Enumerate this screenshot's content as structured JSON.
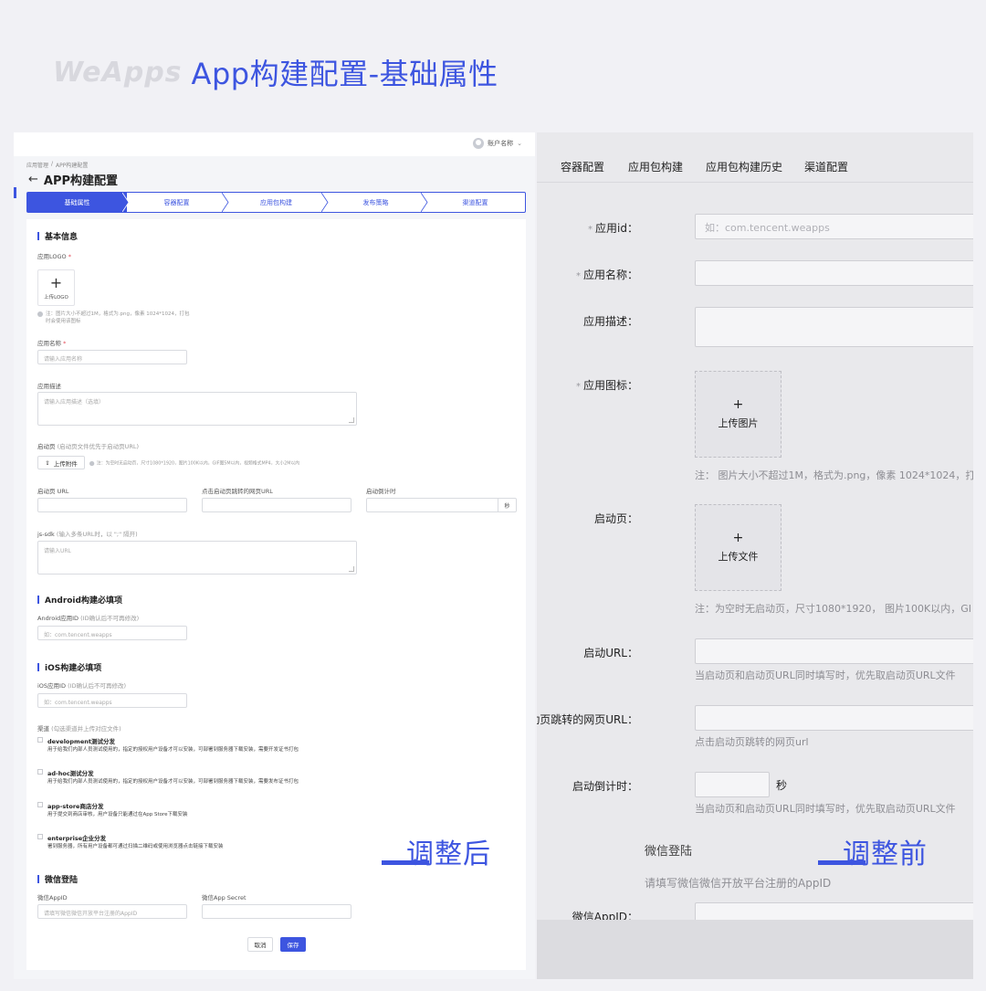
{
  "hero": {
    "brand": "WeApps",
    "title": "App构建配置-基础属性"
  },
  "after": {
    "account": "账户名称",
    "breadcrumb": [
      "应用管理",
      "/",
      "APP构建配置"
    ],
    "page_title": "APP构建配置",
    "steps": [
      "基础属性",
      "容器配置",
      "应用包构建",
      "发布策略",
      "渠道配置"
    ],
    "basic": {
      "title": "基本信息",
      "logo_label": "应用LOGO",
      "logo_upload": "上传LOGO",
      "logo_note": "注：图片大小不超过1M，格式为.png，像素 1024*1024，打包时会使用该图标",
      "name_label": "应用名称",
      "name_placeholder": "请输入应用名称",
      "desc_label": "应用描述",
      "desc_placeholder": "请输入应用描述（选填）",
      "splash_label": "启动页",
      "splash_hint": "(启动页文件优先于启动页URL)",
      "upload_attach": "上传附件",
      "splash_note": "注：为空时无启动页，尺寸1080*1920，图片100K以内，GIF图5M以内，视频格式MP4，大小2M以内",
      "splash_url_label": "启动页 URL",
      "splash_jump_label": "点击启动页跳转的网页URL",
      "countdown_label": "启动倒计时",
      "countdown_unit": "秒",
      "jssdk_label": "js-sdk",
      "jssdk_hint": "(输入多条URL时，以 \";\" 隔开)",
      "jssdk_placeholder": "请输入URL"
    },
    "android": {
      "title": "Android构建必填项",
      "id_label": "Android应用ID",
      "id_hint": "(ID确认后不可再修改)",
      "id_placeholder": "如：com.tencent.weapps"
    },
    "ios": {
      "title": "iOS构建必填项",
      "id_label": "iOS应用ID",
      "id_hint": "(ID确认后不可再修改)",
      "id_placeholder": "如：com.tencent.weapps",
      "channel_label": "渠道",
      "channel_hint": "(勾选渠道并上传对应文件)",
      "channels": [
        {
          "name": "development测试分发",
          "desc": "用于给我们内部人员测试使用的，指定的授权用户设备才可以安装，可部署到服务器下载安装，需要开发证书打包"
        },
        {
          "name": "ad-hoc测试分发",
          "desc": "用于给我们内部人员测试使用的，指定的授权用户设备才可以安装，可部署到服务器下载安装，需要发布证书打包"
        },
        {
          "name": "app-store商店分发",
          "desc": "用于提交到商店审核，用户设备只能通过在App Store下载安装"
        },
        {
          "name": "enterprise企业分发",
          "desc": "署到服务器，所有用户设备都可通过扫描二维码或使用浏览器点击链接下载安装"
        }
      ]
    },
    "wechat": {
      "title": "微信登陆",
      "appid_label": "微信AppID",
      "appid_placeholder": "请填写微信微信开放平台注册的AppID",
      "secret_label": "微信App Secret"
    },
    "buttons": {
      "cancel": "取消",
      "save": "保存"
    },
    "tag": "调整后"
  },
  "before": {
    "tabs": [
      "容器配置",
      "应用包构建",
      "应用包构建历史",
      "渠道配置"
    ],
    "app_id_label": "应用id：",
    "app_id_placeholder": "如：com.tencent.weapps",
    "name_label": "应用名称：",
    "desc_label": "应用描述：",
    "icon_label": "应用图标：",
    "upload_image": "上传图片",
    "icon_note": "注：  图片大小不超过1M，格式为.png，像素 1024*1024，打",
    "splash_label": "启动页：",
    "upload_file": "上传文件",
    "splash_note": "注：为空时无启动页，尺寸1080*1920， 图片100K以内，GI",
    "splash_url_label": "启动URL：",
    "splash_url_note": "当启动页和启动页URL同时填写时，优先取启动页URL文件",
    "jump_url_label": "启动页跳转的网页URL：",
    "jump_url_note": "点击启动页跳转的网页url",
    "countdown_label": "启动倒计时：",
    "countdown_unit": "秒",
    "countdown_note": "当启动页和启动页URL同时填写时，优先取启动页URL文件",
    "wechat_title": "微信登陆",
    "wechat_note": "请填写微信微信开放平台注册的AppID",
    "wechat_appid_label": "微信AppID：",
    "tag": "调整前"
  },
  "colors": {
    "accent": "#3d55e0"
  }
}
